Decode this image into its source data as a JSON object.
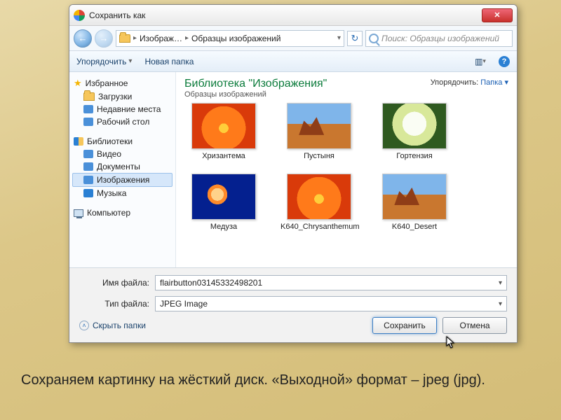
{
  "slide": {
    "caption": "Сохраняем картинку на жёсткий диск. «Выходной» формат – jpeg (jpg)."
  },
  "titlebar": {
    "title": "Сохранить как",
    "close": "✕"
  },
  "nav": {
    "crumb1": "Изображ…",
    "crumb2": "Образцы изображений",
    "search_placeholder": "Поиск: Образцы изображений"
  },
  "toolbar": {
    "organize": "Упорядочить",
    "newfolder": "Новая папка"
  },
  "sidebar": {
    "favorites": "Избранное",
    "fav_items": [
      "Загрузки",
      "Недавние места",
      "Рабочий стол"
    ],
    "libraries": "Библиотеки",
    "lib_items": [
      "Видео",
      "Документы",
      "Изображения",
      "Музыка"
    ],
    "computer": "Компьютер"
  },
  "content": {
    "lib_title": "Библиотека \"Изображения\"",
    "lib_sub": "Образцы изображений",
    "arrange_label": "Упорядочить:",
    "arrange_value": "Папка",
    "thumbs": [
      {
        "label": "Хризантема",
        "cls": "flower-orange"
      },
      {
        "label": "Пустыня",
        "cls": "desert"
      },
      {
        "label": "Гортензия",
        "cls": "hydrangea"
      },
      {
        "label": "Медуза",
        "cls": "jelly"
      },
      {
        "label": "K640_Chrysanthemum",
        "cls": "flower-orange"
      },
      {
        "label": "K640_Desert",
        "cls": "desert"
      }
    ]
  },
  "form": {
    "filename_label": "Имя файла:",
    "filename_value": "flairbutton03145332498201",
    "filetype_label": "Тип файла:",
    "filetype_value": "JPEG Image",
    "hide_folders": "Скрыть папки",
    "save": "Сохранить",
    "cancel": "Отмена"
  }
}
